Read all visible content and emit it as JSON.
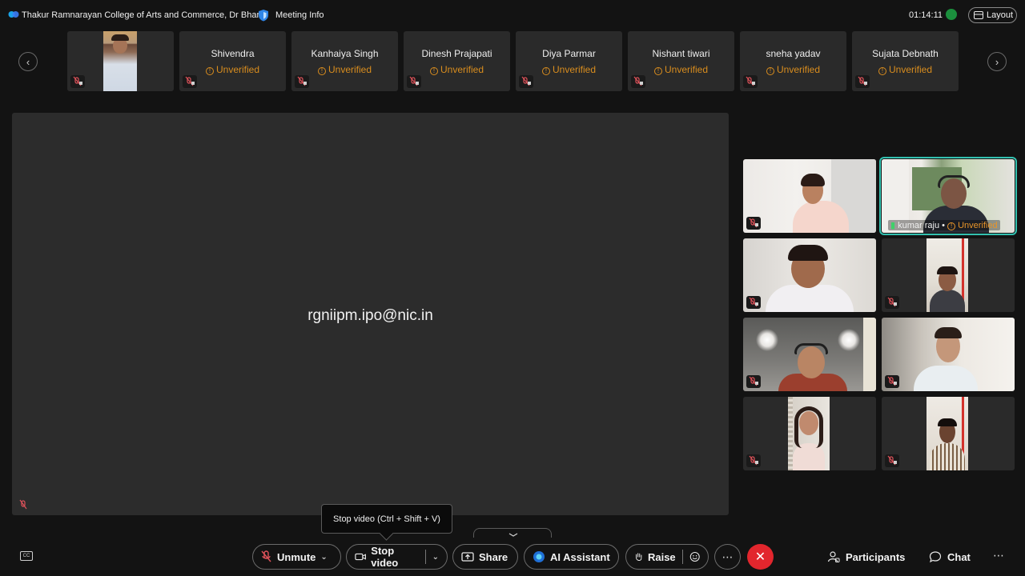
{
  "header": {
    "meeting_title": "Thakur Ramnarayan College of Arts and Commerce, Dr Bharat",
    "meeting_info": "Meeting Info",
    "timer": "01:14:11",
    "layout_label": "Layout"
  },
  "strip": {
    "prev_icon": "chevron-left-icon",
    "next_icon": "chevron-right-icon",
    "participants": [
      {
        "name": "Shivendra",
        "status": "Unverified"
      },
      {
        "name": "Kanhaiya Singh",
        "status": "Unverified"
      },
      {
        "name": "Dinesh Prajapati",
        "status": "Unverified"
      },
      {
        "name": "Diya Parmar",
        "status": "Unverified"
      },
      {
        "name": "Nishant tiwari",
        "status": "Unverified"
      },
      {
        "name": "sneha yadav",
        "status": "Unverified"
      },
      {
        "name": "Sujata Debnath",
        "status": "Unverified"
      }
    ]
  },
  "stage": {
    "name": "rgniipm.ipo@nic.in"
  },
  "grid": {
    "active_name": "kumar raju",
    "active_sep": "•",
    "active_status": "Unverified"
  },
  "tooltip": {
    "text": "Stop video (Ctrl + Shift + V)"
  },
  "controls": {
    "unmute": "Unmute",
    "stop_video": "Stop video",
    "share": "Share",
    "ai_assistant": "AI Assistant",
    "raise": "Raise",
    "participants": "Participants",
    "chat": "Chat",
    "cc": "CC",
    "more": "⋯"
  },
  "colors": {
    "background": "#131313",
    "tile": "#2a2a2a",
    "unverified": "#d98d1e",
    "active_border": "#33c1b0",
    "end_call": "#e2262d"
  }
}
